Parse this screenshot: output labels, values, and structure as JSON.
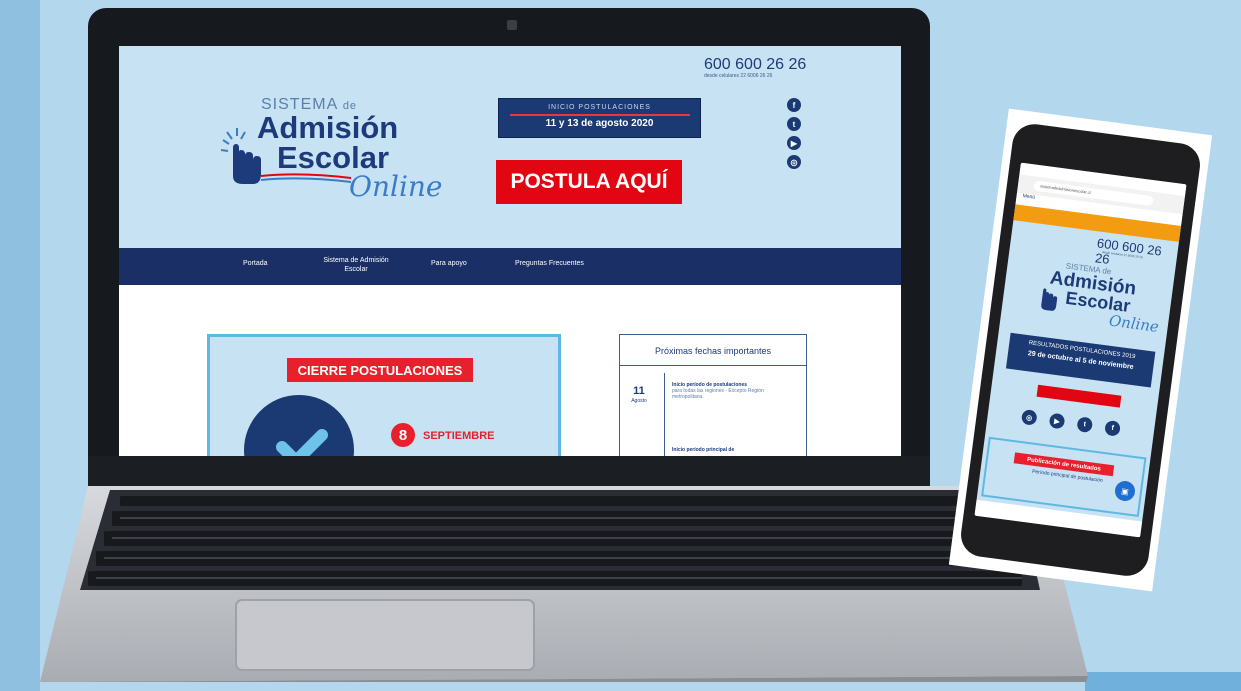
{
  "laptop_site": {
    "logo": {
      "sistema": "SISTEMA",
      "de": "de",
      "admision": "Admisión",
      "escolar": "Escolar",
      "online": "Online"
    },
    "date_banner": {
      "heading": "INICIO POSTULACIONES",
      "dates": "11 y 13 de agosto 2020"
    },
    "cta_label": "POSTULA AQUÍ",
    "phone": {
      "number": "600 600 26 26",
      "subtitle": "desde celulares 22 6006 26 26"
    },
    "social": [
      "f",
      "t",
      "▶",
      "◎"
    ],
    "nav": [
      "Portada",
      "Sistema de Admisión Escolar",
      "Para apoyo",
      "Preguntas Frecuentes"
    ],
    "cierre": {
      "label": "CIERRE POSTULACIONES",
      "day": "8",
      "month": "SEPTIEMBRE"
    },
    "fechas": {
      "title": "Próximas fechas importantes",
      "day": "11",
      "month": "Agosto",
      "event_title": "Inicio período de postulaciones",
      "event_detail": "para todas las regiones - Excepto Región metropolitana",
      "event2_title": "Inicio período principal de"
    }
  },
  "phone_site": {
    "url": "sistemadeadmisionescolar.cl",
    "menu_label": "Menú",
    "phone_number": "600 600 26 26",
    "logo": {
      "sistema": "SISTEMA de",
      "admision": "Admisión",
      "escolar": "Escolar",
      "online": "Online"
    },
    "result": {
      "title": "RESULTADOS POSTULACIONES 2019",
      "dates": "29 de octubre al 5 de noviembre"
    },
    "social": [
      "◎",
      "▶",
      "t",
      "f"
    ],
    "publication": {
      "label": "Publicación de resultados",
      "subtitle": "Período principal de postulación"
    }
  },
  "colors": {
    "background": "#b3d8ee",
    "navy": "#1b3a74",
    "red": "#e20613",
    "light_blue": "#c6e2f3",
    "orange": "#f39c12"
  }
}
